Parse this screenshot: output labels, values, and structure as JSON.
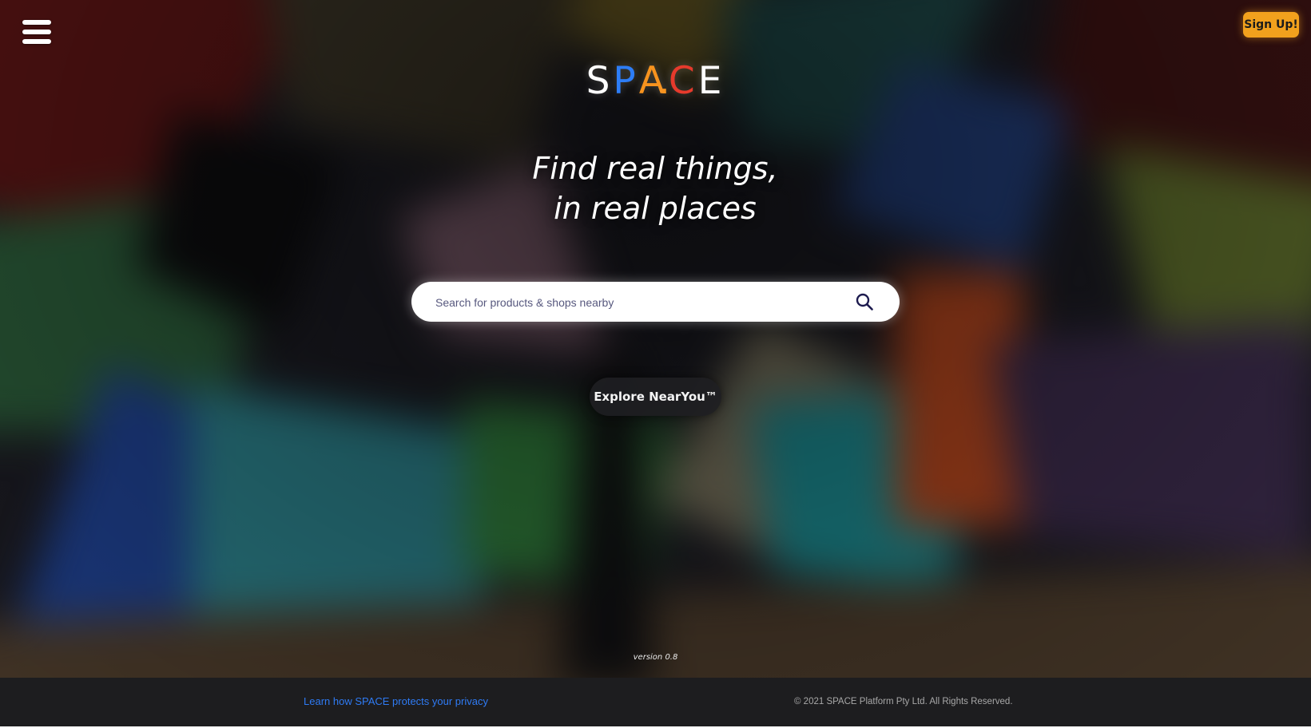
{
  "header": {
    "menu_icon": "hamburger-menu-icon",
    "signup_label": "Sign Up!"
  },
  "logo": {
    "letters": [
      "S",
      "P",
      "A",
      ".",
      "C",
      "E"
    ],
    "colors": {
      "S": "#ffffff",
      "P": "#2d7df6",
      "A": "#f7931e",
      "C": "#e63a2c",
      "E": "#ffffff"
    }
  },
  "tagline": {
    "line1": "Find real things,",
    "line2": "in real places"
  },
  "search": {
    "placeholder": "Search for products & shops nearby",
    "icon": "search-icon"
  },
  "explore": {
    "label": "Explore NearYou™"
  },
  "version_text": "version 0.8",
  "footer": {
    "privacy_link": "Learn how SPACE protects your privacy",
    "copyright": "© 2021 SPACE Platform Pty Ltd. All Rights Reserved."
  },
  "colors": {
    "signup_bg": "#f2a11d",
    "link": "#2f7bf4",
    "footer_bg": "#1d1d1f"
  }
}
